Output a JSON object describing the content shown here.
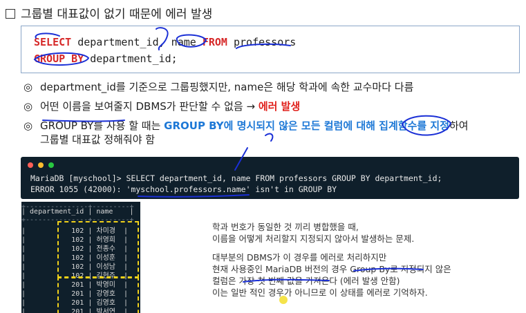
{
  "slide": {
    "title": "그룹별 대표값이 없기 때문에 에러 발생"
  },
  "code": {
    "line1_kw1": "SELECT",
    "line1_mid": " department_id, name ",
    "line1_kw2": "FROM",
    "line1_end": " professors",
    "line2_kw": "GROUP BY",
    "line2_end": " department_id;"
  },
  "bullets": {
    "mark": "◎",
    "b1": "department_id를 기준으로 그룹핑했지만, name은 해당 학과에 속한 교수마다 다름",
    "b2_text": "어떤 이름을 보여줄지 DBMS가 판단할 수 없음 → ",
    "b2_red": "에러 발생",
    "b3_pre": "GROUP BY를 사용 할 때는 ",
    "b3_blue": "GROUP BY에 명시되지 않은 모든 컬럼에 대해 집계함수를 지정",
    "b3_post": "하여",
    "b3_line2": "그룹별 대표값 정해줘야 함"
  },
  "terminal": {
    "prompt_cmd": "MariaDB [myschool]> SELECT department_id, name FROM professors GROUP BY department_id;",
    "error": "ERROR 1055 (42000): 'myschool.professors.name' isn't in GROUP BY",
    "dot_colors": [
      "#ff5f57",
      "#febc2e",
      "#28c840"
    ]
  },
  "result_table": {
    "border_top": "+---------------+---------+",
    "header": "| department_id | name    |",
    "border_mid": "+---------------+---------+",
    "rows": [
      "|           102 | 차미경  |",
      "|           102 | 허영희  |",
      "|           102 | 전종수  |",
      "|           102 | 이성훈  |",
      "|           102 | 이성남  |",
      "|           102 | 김현주  |",
      "|           201 | 박영미  |",
      "|           201 | 강영호  |",
      "|           201 | 김영호  |",
      "|           201 | 박서연  |"
    ]
  },
  "notes": {
    "p1_l1": "학과 번호가 동일한 것 끼리 병합했을 때,",
    "p1_l2": "이름을 어떻게 처리할지 지정되지 않아서 발생하는 문제.",
    "p2_l1": "대부분의 DBMS가 이 경우를 에러로 처리하지만",
    "p2_l2": "현재 사용중인 MariaDB 버전의 경우 Group By로 지정되지 않은",
    "p2_l3": "컬럼은 가장 첫 번째 값을 가져온다 (에러 발생 안함)",
    "p2_l4": "이는 일반 적인 경우가 아니므로 이 상태를 에러로 기억하자."
  },
  "colors": {
    "accent_red": "#e0201b",
    "accent_blue": "#1d78d6",
    "terminal_bg": "#0f1f2b",
    "highlight_yellow": "#f2d21a",
    "arrow_orange": "#f08a24",
    "ink_blue": "#1a2fd6"
  }
}
